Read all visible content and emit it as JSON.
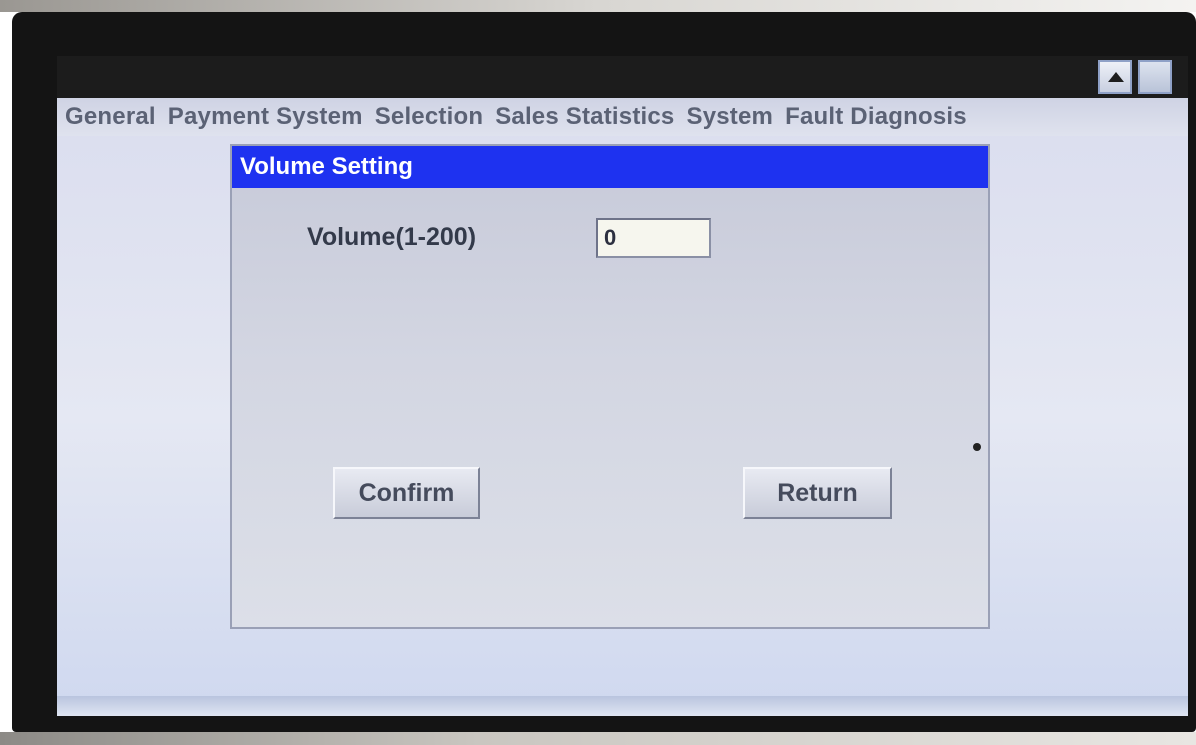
{
  "menu": {
    "items": [
      {
        "label": "General"
      },
      {
        "label": "Payment System"
      },
      {
        "label": "Selection"
      },
      {
        "label": "Sales Statistics"
      },
      {
        "label": "System"
      },
      {
        "label": "Fault Diagnosis"
      }
    ]
  },
  "window_controls": {
    "scroll_up_icon": "triangle-up-icon",
    "blank_icon": "blank-square-icon"
  },
  "dialog": {
    "title": "Volume Setting",
    "volume_label": "Volume(1-200)",
    "volume_value": "0",
    "confirm_label": "Confirm",
    "return_label": "Return"
  },
  "colors": {
    "dialog_title_bg": "#1e32f0",
    "titlebar_bg": "#1c1c1c",
    "menu_text": "#5b6275"
  }
}
